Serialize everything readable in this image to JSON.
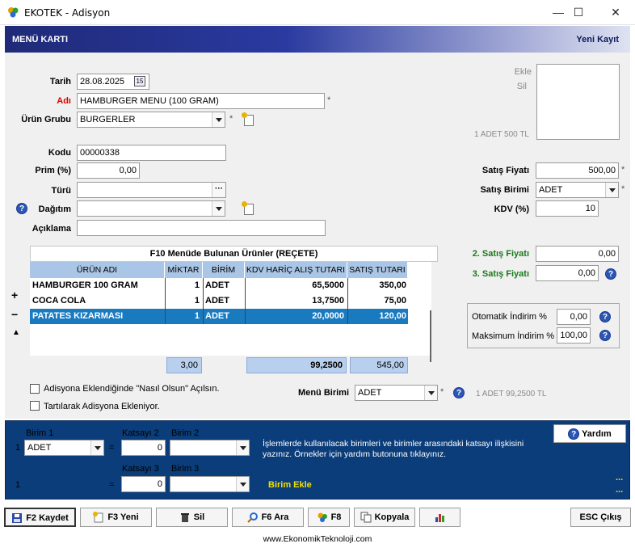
{
  "window": {
    "title": "EKOTEK - Adisyon",
    "minimize": "—",
    "maximize": "☐",
    "close": "✕"
  },
  "header": {
    "left": "MENÜ KARTI",
    "right": "Yeni Kayıt"
  },
  "form": {
    "tarih_label": "Tarih",
    "tarih_value": "28.08.2025",
    "calendar_glyph": "15",
    "adi_label": "Adı",
    "adi_value": "HAMBURGER MENU (100 GRAM)",
    "urun_grubu_label": "Ürün Grubu",
    "urun_grubu_value": "BURGERLER",
    "kodu_label": "Kodu",
    "kodu_value": "00000338",
    "prim_label": "Prim (%)",
    "prim_value": "0,00",
    "turu_label": "Türü",
    "turu_value": "",
    "ellipsis": "···",
    "dagitim_label": "Dağıtım",
    "dagitim_value": "",
    "aciklama_label": "Açıklama",
    "aciklama_value": "",
    "star": "*",
    "help_glyph": "?"
  },
  "image_panel": {
    "ekle": "Ekle",
    "sil": "Sil",
    "info": "1 ADET 500 TL"
  },
  "pricing": {
    "satis_fiyati_label": "Satış Fiyatı",
    "satis_fiyati_value": "500,00",
    "satis_birimi_label": "Satış Birimi",
    "satis_birimi_value": "ADET",
    "kdv_label": "KDV (%)",
    "kdv_value": "10",
    "satis_fiyati_2_label": "2. Satış Fiyatı",
    "satis_fiyati_2_value": "0,00",
    "satis_fiyati_3_label": "3. Satış Fiyatı",
    "satis_fiyati_3_value": "0,00"
  },
  "discount": {
    "otomatik_label": "Otomatik İndirim %",
    "otomatik_value": "0,00",
    "maksimum_label": "Maksimum İndirim %",
    "maksimum_value": "100,00"
  },
  "recipe": {
    "title": "F10 Menüde Bulunan Ürünler (REÇETE)",
    "columns": [
      "ÜRÜN ADI",
      "MİKTAR",
      "BİRİM",
      "KDV HARİÇ ALIŞ TUTARI",
      "SATIŞ TUTARI"
    ],
    "rows": [
      {
        "name": "HAMBURGER 100 GRAM",
        "qty": "1",
        "unit": "ADET",
        "cost": "65,5000",
        "sale": "350,00"
      },
      {
        "name": "COCA COLA",
        "qty": "1",
        "unit": "ADET",
        "cost": "13,7500",
        "sale": "75,00"
      },
      {
        "name": "PATATES KIZARMASI",
        "qty": "1",
        "unit": "ADET",
        "cost": "20,0000",
        "sale": "120,00"
      }
    ],
    "total_qty": "3,00",
    "total_cost": "99,2500",
    "total_sale": "545,00",
    "add_glyph": "+",
    "remove_glyph": "−",
    "up_glyph": "▲"
  },
  "options": {
    "nasil_olsun": "Adisyona Eklendiğinde \"Nasıl Olsun\" Açılsın.",
    "tartilarak": "Tartılarak Adisyona Ekleniyor.",
    "menu_birimi_label": "Menü Birimi",
    "menu_birimi_value": "ADET",
    "menu_info": "1 ADET 99,2500 TL"
  },
  "units": {
    "birim1_label": "Birim 1",
    "katsayi2_label": "Katsayı 2",
    "birim2_label": "Birim 2",
    "katsayi3_label": "Katsayı 3",
    "birim3_label": "Birim 3",
    "row1_num": "1",
    "row2_num": "1",
    "eq": "=",
    "birim1_value": "ADET",
    "katsayi2_value": "0",
    "katsayi3_value": "0",
    "info_text": "İşlemlerde kullanılacak birimleri ve birimler arasındaki katsayı ilişkisini yazınız. Örnekler için yardım butonuna tıklayınız.",
    "birim_ekle": "Birim Ekle",
    "yardim": "Yardım",
    "dots": "..."
  },
  "toolbar": {
    "kaydet": "F2 Kaydet",
    "yeni": "F3 Yeni",
    "sil": "Sil",
    "ara": "F6 Ara",
    "f8": "F8",
    "kopyala": "Kopyala",
    "cikis": "ESC Çıkış"
  },
  "footer": {
    "url": "www.EkonomikTeknoloji.com"
  },
  "colors": {
    "header_dark": "#1f2a78",
    "panel_blue": "#0b3d7a",
    "selected_row": "#1a7ac0",
    "grid_header": "#aac6e6"
  }
}
